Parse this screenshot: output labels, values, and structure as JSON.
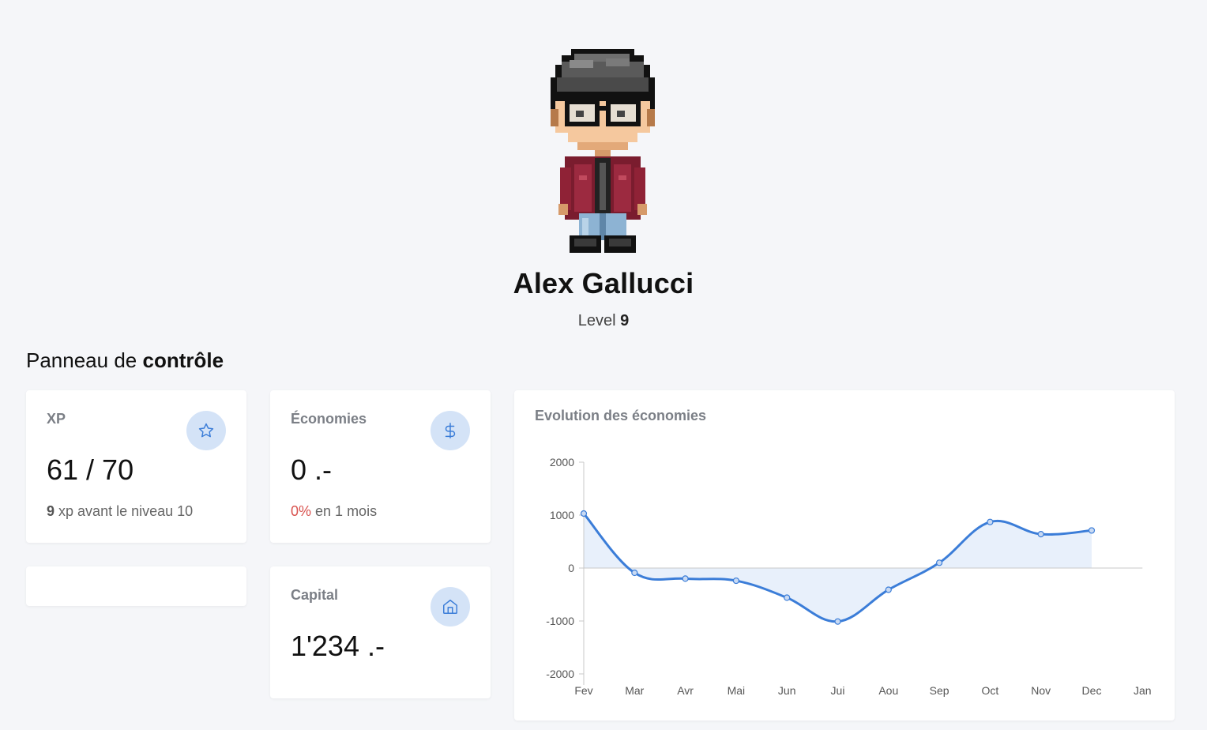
{
  "profile": {
    "name": "Alex Gallucci",
    "level_label": "Level",
    "level_value": "9"
  },
  "panel": {
    "title_prefix": "Panneau de",
    "title_bold": "contrôle"
  },
  "cards": {
    "xp": {
      "label": "XP",
      "value": "61 / 70",
      "sub_bold": "9",
      "sub_text": "xp avant le niveau 10",
      "icon": "star-icon"
    },
    "economies": {
      "label": "Économies",
      "value": "0 .-",
      "sub_percent": "0%",
      "sub_text": "en 1 mois",
      "icon": "dollar-icon"
    },
    "capital": {
      "label": "Capital",
      "value": "1'234 .-",
      "icon": "home-icon"
    }
  },
  "colors": {
    "accent": "#3b7dd8",
    "icon_bg": "#d4e3f7",
    "negative": "#d9534f",
    "fill": "#e6eefb"
  },
  "chart_data": {
    "type": "area",
    "title": "Evolution des économies",
    "categories": [
      "Fev",
      "Mar",
      "Avr",
      "Mai",
      "Jun",
      "Jui",
      "Aou",
      "Sep",
      "Oct",
      "Nov",
      "Dec",
      "Jan"
    ],
    "values": [
      1030,
      -90,
      -200,
      -240,
      -560,
      -1010,
      -410,
      100,
      870,
      640,
      710,
      null
    ],
    "ylim": [
      -2000,
      2000
    ],
    "yticks": [
      2000,
      1000,
      0,
      -1000,
      -2000
    ],
    "grid": false,
    "legend": "none"
  }
}
